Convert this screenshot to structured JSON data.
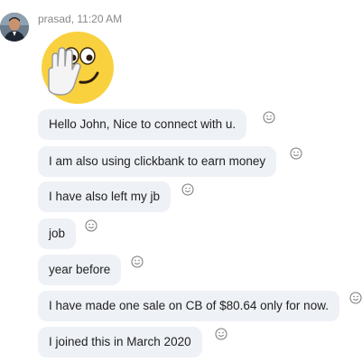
{
  "sender": {
    "name": "prasad",
    "time": "11:20 AM",
    "meta": "prasad, 11:20 AM"
  },
  "messages": [
    {
      "text": "Hello John, Nice to connect with u."
    },
    {
      "text": "I am also using clickbank to earn money"
    },
    {
      "text": "I have also left my jb"
    },
    {
      "text": "job"
    },
    {
      "text": "year before"
    },
    {
      "text": "I have made one sale on CB of $80.64 only for now."
    },
    {
      "text": "I joined this in March 2020"
    }
  ],
  "icons": {
    "avatar": "user-avatar",
    "sticker": "waving-face-emoji",
    "reaction": "smiley-reaction-icon"
  },
  "colors": {
    "bubble_bg": "#eef1f5",
    "meta_text": "#888888",
    "emoji_yellow": "#f9d13e"
  }
}
